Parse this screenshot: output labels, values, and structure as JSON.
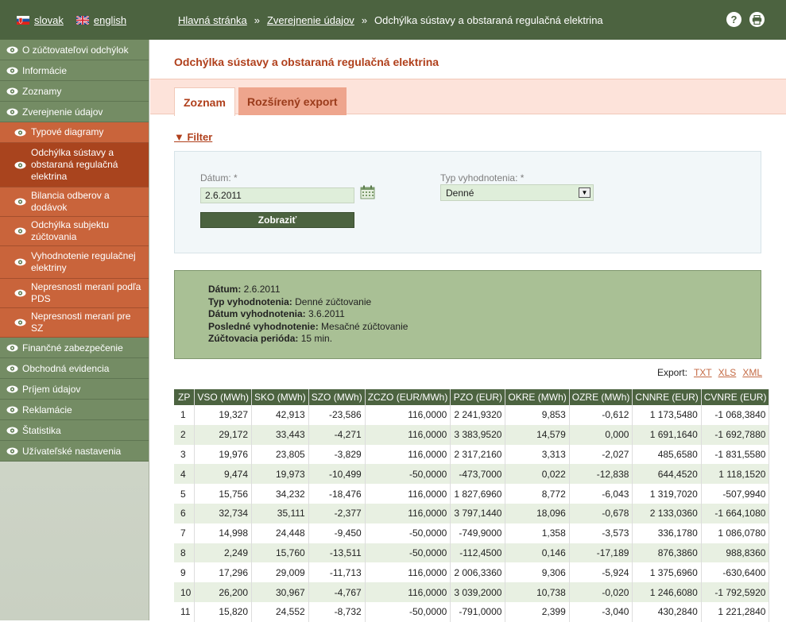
{
  "languages": [
    {
      "label": "slovak",
      "flag": "sk-flag-icon"
    },
    {
      "label": "english",
      "flag": "uk-flag-icon"
    }
  ],
  "breadcrumb": {
    "home": "Hlavná stránka",
    "section": "Zverejnenie údajov ",
    "current": "Odchýlka sústavy a obstaraná regulačná elektrina",
    "separator": "»"
  },
  "top_icons": {
    "help": "?",
    "print": "print-icon"
  },
  "sidebar": {
    "items_top": [
      "O zúčtovateľovi odchýlok",
      "Informácie",
      "Zoznamy",
      "Zverejnenie údajov"
    ],
    "sub_items": [
      {
        "label": "Typové diagramy",
        "active": false
      },
      {
        "label": "Odchýlka sústavy a obstaraná regulačná elektrina",
        "active": true
      },
      {
        "label": "Bilancia odberov a dodávok",
        "active": false
      },
      {
        "label": "Odchýlka subjektu zúčtovania",
        "active": false
      },
      {
        "label": "Vyhodnotenie regulačnej elektriny",
        "active": false
      },
      {
        "label": "Nepresnosti meraní podľa PDS",
        "active": false
      },
      {
        "label": "Nepresnosti meraní pre SZ",
        "active": false
      }
    ],
    "items_bottom": [
      "Finančné zabezpečenie",
      "Obchodná evidencia",
      "Príjem údajov",
      "Reklamácie",
      "Štatistika",
      "Užívateľské nastavenia"
    ]
  },
  "page": {
    "title": "Odchýlka sústavy a obstaraná regulačná elektrina"
  },
  "tabs": [
    {
      "label": "Zoznam",
      "active": true
    },
    {
      "label": "Rozšírený export",
      "active": false
    }
  ],
  "filter": {
    "toggle_label": "▼ Filter",
    "date_label": "Dátum: *",
    "date_value": "2.6.2011",
    "type_label": "Typ vyhodnotenia: *",
    "type_value": "Denné",
    "submit_label": "Zobraziť"
  },
  "summary": [
    {
      "label": "Dátum:",
      "value": " 2.6.2011"
    },
    {
      "label": "Typ vyhodnotenia:",
      "value": " Denné zúčtovanie"
    },
    {
      "label": "Dátum vyhodnotenia:",
      "value": " 3.6.2011"
    },
    {
      "label": "Posledné vyhodnotenie:",
      "value": " Mesačné zúčtovanie"
    },
    {
      "label": "Zúčtovacia perióda:",
      "value": " 15 min."
    }
  ],
  "export": {
    "label": "Export:",
    "links": [
      "TXT",
      "XLS",
      "XML"
    ]
  },
  "table": {
    "headers": [
      "ZP",
      "VSO (MWh)",
      "SKO (MWh)",
      "SZO (MWh)",
      "ZCZO (EUR/MWh)",
      "PZO (EUR)",
      "OKRE (MWh)",
      "OZRE (MWh)",
      "CNNRE (EUR)",
      "CVNRE (EUR)"
    ],
    "rows": [
      [
        "1",
        "19,327",
        "42,913",
        "-23,586",
        "116,0000",
        "2 241,9320",
        "9,853",
        "-0,612",
        "1 173,5480",
        "-1 068,3840"
      ],
      [
        "2",
        "29,172",
        "33,443",
        "-4,271",
        "116,0000",
        "3 383,9520",
        "14,579",
        "0,000",
        "1 691,1640",
        "-1 692,7880"
      ],
      [
        "3",
        "19,976",
        "23,805",
        "-3,829",
        "116,0000",
        "2 317,2160",
        "3,313",
        "-2,027",
        "485,6580",
        "-1 831,5580"
      ],
      [
        "4",
        "9,474",
        "19,973",
        "-10,499",
        "-50,0000",
        "-473,7000",
        "0,022",
        "-12,838",
        "644,4520",
        "1 118,1520"
      ],
      [
        "5",
        "15,756",
        "34,232",
        "-18,476",
        "116,0000",
        "1 827,6960",
        "8,772",
        "-6,043",
        "1 319,7020",
        "-507,9940"
      ],
      [
        "6",
        "32,734",
        "35,111",
        "-2,377",
        "116,0000",
        "3 797,1440",
        "18,096",
        "-0,678",
        "2 133,0360",
        "-1 664,1080"
      ],
      [
        "7",
        "14,998",
        "24,448",
        "-9,450",
        "-50,0000",
        "-749,9000",
        "1,358",
        "-3,573",
        "336,1780",
        "1 086,0780"
      ],
      [
        "8",
        "2,249",
        "15,760",
        "-13,511",
        "-50,0000",
        "-112,4500",
        "0,146",
        "-17,189",
        "876,3860",
        "988,8360"
      ],
      [
        "9",
        "17,296",
        "29,009",
        "-11,713",
        "116,0000",
        "2 006,3360",
        "9,306",
        "-5,924",
        "1 375,6960",
        "-630,6400"
      ],
      [
        "10",
        "26,200",
        "30,967",
        "-4,767",
        "116,0000",
        "3 039,2000",
        "10,738",
        "-0,020",
        "1 246,6080",
        "-1 792,5920"
      ],
      [
        "11",
        "15,820",
        "24,552",
        "-8,732",
        "-50,0000",
        "-791,0000",
        "2,399",
        "-3,040",
        "430,2840",
        "1 221,2840"
      ]
    ]
  },
  "colors": {
    "header_green": "#4c6340",
    "nav_green": "#748c64",
    "nav_orange": "#c9643b",
    "nav_active": "#a9441e",
    "title_red": "#b0401c",
    "summary_green": "#a9c095"
  }
}
